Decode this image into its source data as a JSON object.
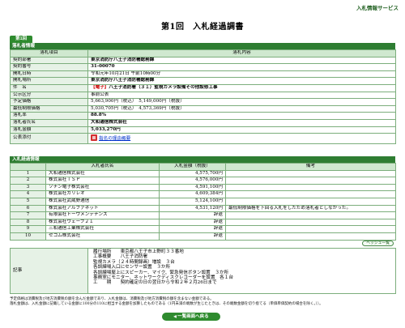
{
  "header": {
    "service_link": "入札情報サービス",
    "title": "第1回　入札経過調書",
    "round_tab": "第1回"
  },
  "bid_info": {
    "section_label": "落札者情報",
    "col_item": "落札項目",
    "col_content": "落札内容",
    "rows": [
      {
        "label": "契約部署",
        "value": "東京消防庁八王子消防署総務課"
      },
      {
        "label": "契約番号",
        "value": "31-00070"
      },
      {
        "label": "開札日時",
        "value": "令和元年10月21日 午前10時00分"
      },
      {
        "label": "開札場所",
        "value": "東京消防庁八王子消防署総務課"
      },
      {
        "label": "件　名",
        "tag": "【電子】",
        "value": "八王子消防署（３１）監視カメラ設備その他設修工事"
      },
      {
        "label": "公示区分",
        "value": "事前公表"
      },
      {
        "label": "予定価格",
        "value": "5,663,900円（税込）　5,149,000円（税抜）"
      },
      {
        "label": "最低制限価格",
        "value": "5,030,705円（税込）　4,573,369円（税抜）"
      },
      {
        "label": "落札率",
        "value": "88.8%"
      },
      {
        "label": "落札者氏名",
        "value": "大和通信株式会社"
      },
      {
        "label": "落札金額",
        "value": "5,033,270円"
      },
      {
        "label": "公表添付",
        "link": "指名の理由概要"
      }
    ]
  },
  "bid_history": {
    "section_label": "入札経過情報",
    "col_name": "入札者氏名",
    "col_amount": "入札金額（税抜）",
    "col_note": "備考",
    "rows": [
      {
        "no": "1",
        "name": "大和通信株式会社",
        "amount": "4,575,700円",
        "note": ""
      },
      {
        "no": "2",
        "name": "株式会社ＴＳＰ",
        "amount": "4,576,000円",
        "note": ""
      },
      {
        "no": "3",
        "name": "ソナン電子株式会社",
        "amount": "4,591,100円",
        "note": ""
      },
      {
        "no": "4",
        "name": "株式会社ガリレオ",
        "amount": "4,609,384円",
        "note": ""
      },
      {
        "no": "5",
        "name": "株式会社武蔵野通信",
        "amount": "5,124,100円",
        "note": ""
      },
      {
        "no": "6",
        "name": "株式会社アルファネット",
        "amount": "4,531,120円",
        "note": "最低制限価格を下回る入札をしたため落札者としなかった。"
      },
      {
        "no": "7",
        "name": "有限会社トーワメンテナンス",
        "amount": "辞退",
        "note": ""
      },
      {
        "no": "8",
        "name": "株式会社ウェーブ２１",
        "amount": "辞退",
        "note": ""
      },
      {
        "no": "9",
        "name": "三和通信工業株式会社",
        "amount": "辞退",
        "note": ""
      },
      {
        "no": "10",
        "name": "セコム株式会社",
        "amount": "辞退",
        "note": ""
      }
    ],
    "batch_button": "ヘッシュ一覧"
  },
  "memo": {
    "label": "記事",
    "text": "履行場所　　東京都八王子市上野町３３番地\n工事概要　　八王子消防署\n監視カメラ（２４時間録画）増設　３台\n各訓練場入口にセンサー設置　３か所\n各訓練場屋上にスピーカー、マイク、緊急発信ボタン設置　３か所\n事務室にモニター、ネットワークディスクレコーダーを設置　各１台\n工　　期　　契約確定の日の翌日から令和２年２月26日まで"
  },
  "notes": [
    "予定価格は消費税及び地方消費税の額を含んだ金額であり、入札金額は、消費税及び地方消費税の額を含まない金額である。",
    "落札金額は、入札金額に記載している金額に100分の110に相当する金額を加算したものである（1円未満の端数が生じたときは、その端数金額を切り捨てる（単価単価契約の場合を除く。））。"
  ],
  "footer": {
    "back_button": "一覧画面へ戻る"
  },
  "colors": {
    "section_bg": "#2e7d32",
    "header_bg": "#cfe8cf",
    "label_bg": "#e6f2e6",
    "border": "#7cae7c",
    "tag_red": "#cc0000"
  }
}
